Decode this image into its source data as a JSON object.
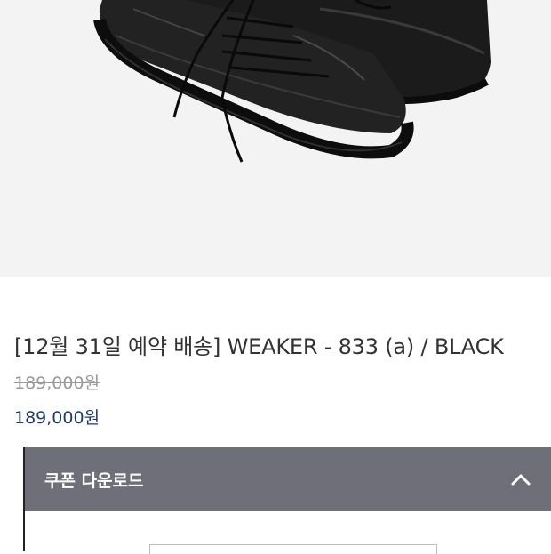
{
  "product": {
    "image_alt": "black leather sneaker",
    "title": "[12월 31일 예약 배송] WEAKER - 833 (a) / BLACK",
    "original_price": "189,000원",
    "sale_price": "189,000원"
  },
  "coupon": {
    "label": "쿠폰 다운로드",
    "toggle_icon": "chevron-up-icon"
  },
  "colors": {
    "hero_bg": "#f3f3f3",
    "sale_price": "#1e3a6e",
    "coupon_bar": "#6f6f7a"
  }
}
